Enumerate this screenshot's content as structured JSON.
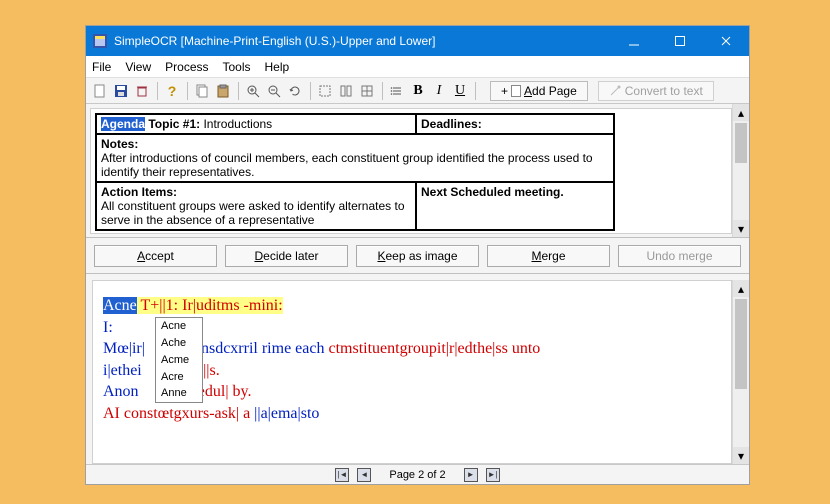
{
  "window": {
    "title": "SimpleOCR [Machine-Print-English (U.S.)-Upper and Lower]"
  },
  "menu": {
    "file": "File",
    "view": "View",
    "process": "Process",
    "tools": "Tools",
    "help": "Help"
  },
  "toolbar": {
    "add_page_prefix": "+",
    "add_page_underline": "A",
    "add_page_rest": "dd Page",
    "convert_text": "Convert to text"
  },
  "doc": {
    "agenda_label": "Agenda",
    "topic_label": " Topic #1: ",
    "topic_value": "Introductions",
    "deadlines_label": "Deadlines:",
    "notes_label": "Notes:",
    "notes_body": "After introductions of council members, each constituent group identified the process used to identify their representatives.",
    "action_label": "Action Items:",
    "action_body": "All constituent groups were asked to identify alternates to serve in the absence of a representative",
    "next_label": "Next Scheduled meeting."
  },
  "buttons": {
    "accept": "Accept",
    "decide": "Decide later",
    "keep": "Keep as image",
    "merge": "Merge",
    "undo": "Undo merge"
  },
  "ocr": {
    "l1_sel": "Acne",
    "l1_rest": " T+||1: Ir|uditms -mini:",
    "l2": "I:",
    "l3_a": "Mœ|ir|",
    "l3_b": "nsdcxrril rime each ",
    "l3_c": "ctmstituentgroupit|r|edthe|ss unto",
    "l4_a": "i|ethei",
    "l4_b": "r||s.",
    "l5_a": "Anon",
    "l5_b": "|edul| by.",
    "l6_a": "AI constœtgxurs-ask| a ",
    "l6_b": "||a|ema|sto",
    "suggest": [
      "Acne",
      "Ache",
      "Acme",
      "Acre",
      "Anne"
    ]
  },
  "status": {
    "page": "Page 2 of 2"
  }
}
